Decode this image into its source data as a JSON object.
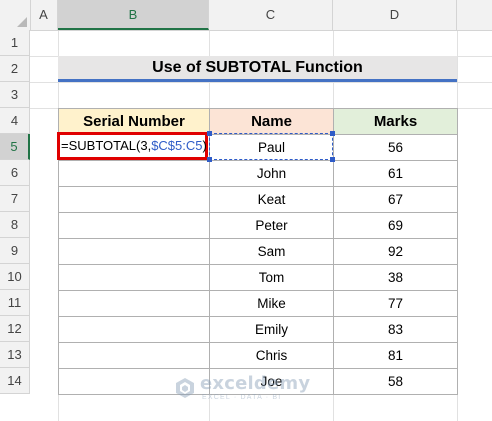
{
  "columns": [
    "A",
    "B",
    "C",
    "D"
  ],
  "active_column": "B",
  "rows": [
    "1",
    "2",
    "3",
    "4",
    "5",
    "6",
    "7",
    "8",
    "9",
    "10",
    "11",
    "12",
    "13",
    "14"
  ],
  "active_row": "5",
  "title": "Use of SUBTOTAL Function",
  "headers": {
    "serial": "Serial Number",
    "name": "Name",
    "marks": "Marks"
  },
  "formula": {
    "prefix": "=SUBTOTAL(3,",
    "ref": "$C$5:C5",
    "suffix": ")"
  },
  "records": [
    {
      "name": "Paul",
      "marks": "56"
    },
    {
      "name": "John",
      "marks": "61"
    },
    {
      "name": "Keat",
      "marks": "67"
    },
    {
      "name": "Peter",
      "marks": "69"
    },
    {
      "name": "Sam",
      "marks": "92"
    },
    {
      "name": "Tom",
      "marks": "38"
    },
    {
      "name": "Mike",
      "marks": "77"
    },
    {
      "name": "Emily",
      "marks": "83"
    },
    {
      "name": "Chris",
      "marks": "81"
    },
    {
      "name": "Joe",
      "marks": "58"
    }
  ],
  "watermark": {
    "title": "exceldemy",
    "subtitle": "EXCEL · DATA · BI"
  },
  "colors": {
    "serial_header": "#fff2cc",
    "name_header": "#fce4d6",
    "marks_header": "#e2efda",
    "title_underline": "#4472c4",
    "formula_border": "#e00000",
    "reference": "#2f5cc8",
    "selection": "#217346"
  }
}
